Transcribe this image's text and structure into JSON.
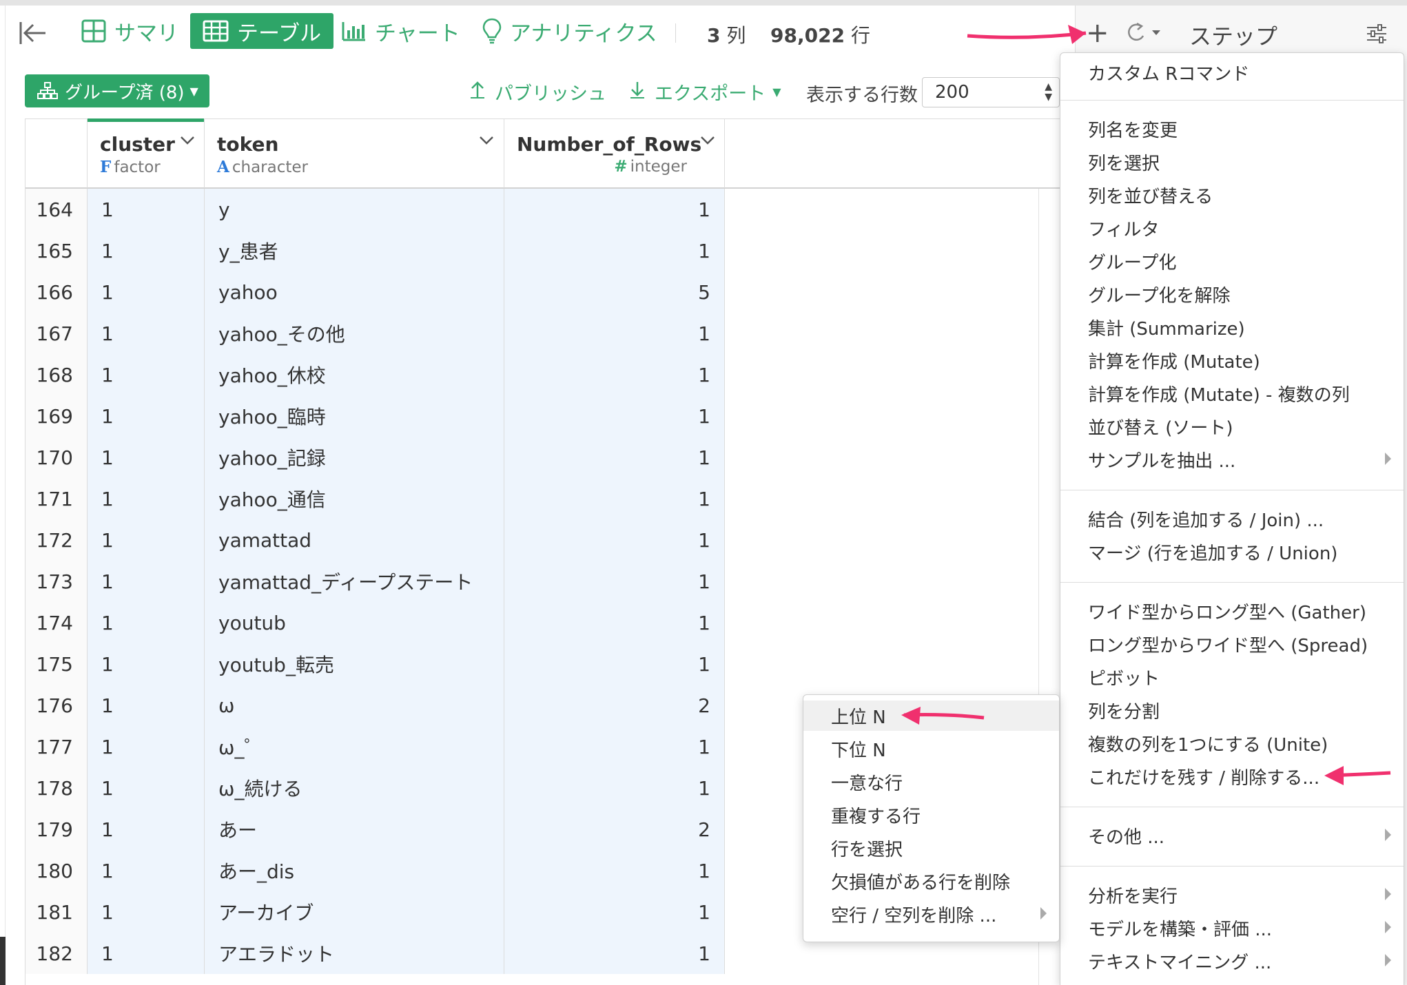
{
  "toolbar": {
    "tabs": [
      {
        "label": "サマリ",
        "icon": "summary-grid-icon"
      },
      {
        "label": "テーブル",
        "icon": "table-icon"
      },
      {
        "label": "チャート",
        "icon": "bar-chart-icon"
      },
      {
        "label": "アナリティクス",
        "icon": "lightbulb-icon"
      }
    ],
    "columns_count": "3",
    "columns_unit": "列",
    "rows_count": "98,022",
    "rows_unit": "行"
  },
  "subbar": {
    "grouped_label": "グループ済 (8)",
    "publish_label": "パブリッシュ",
    "export_label": "エクスポート",
    "rows_to_show_label": "表示する行数",
    "rows_to_show_value": "200"
  },
  "table": {
    "columns": [
      {
        "name": "cluster",
        "type_letter": "F",
        "type": "factor"
      },
      {
        "name": "token",
        "type_letter": "A",
        "type": "character"
      },
      {
        "name": "Number_of_Rows",
        "type_letter": "#",
        "type": "integer"
      }
    ],
    "rows": [
      {
        "idx": "164",
        "cluster": "1",
        "token": "y",
        "count": "1"
      },
      {
        "idx": "165",
        "cluster": "1",
        "token": "y_患者",
        "count": "1"
      },
      {
        "idx": "166",
        "cluster": "1",
        "token": "yahoo",
        "count": "5"
      },
      {
        "idx": "167",
        "cluster": "1",
        "token": "yahoo_その他",
        "count": "1"
      },
      {
        "idx": "168",
        "cluster": "1",
        "token": "yahoo_休校",
        "count": "1"
      },
      {
        "idx": "169",
        "cluster": "1",
        "token": "yahoo_臨時",
        "count": "1"
      },
      {
        "idx": "170",
        "cluster": "1",
        "token": "yahoo_記録",
        "count": "1"
      },
      {
        "idx": "171",
        "cluster": "1",
        "token": "yahoo_通信",
        "count": "1"
      },
      {
        "idx": "172",
        "cluster": "1",
        "token": "yamattad",
        "count": "1"
      },
      {
        "idx": "173",
        "cluster": "1",
        "token": "yamattad_ディープステート",
        "count": "1"
      },
      {
        "idx": "174",
        "cluster": "1",
        "token": "youtub",
        "count": "1"
      },
      {
        "idx": "175",
        "cluster": "1",
        "token": "youtub_転売",
        "count": "1"
      },
      {
        "idx": "176",
        "cluster": "1",
        "token": "ω",
        "count": "2"
      },
      {
        "idx": "177",
        "cluster": "1",
        "token": "ω_゜",
        "count": "1"
      },
      {
        "idx": "178",
        "cluster": "1",
        "token": "ω_続ける",
        "count": "1"
      },
      {
        "idx": "179",
        "cluster": "1",
        "token": "あー",
        "count": "2"
      },
      {
        "idx": "180",
        "cluster": "1",
        "token": "あー_dis",
        "count": "1"
      },
      {
        "idx": "181",
        "cluster": "1",
        "token": "アーカイブ",
        "count": "1"
      },
      {
        "idx": "182",
        "cluster": "1",
        "token": "アエラドット",
        "count": "1"
      }
    ]
  },
  "steps": {
    "title": "ステップ",
    "add_icon": "plus-icon",
    "refresh_icon": "refresh-icon",
    "settings_icon": "sliders-icon"
  },
  "add_menu": {
    "custom_r": "カスタム Rコマンド",
    "group1": [
      "列名を変更",
      "列を選択",
      "列を並び替える",
      "フィルタ",
      "グループ化",
      "グループ化を解除",
      "集計 (Summarize)",
      "計算を作成 (Mutate)",
      "計算を作成 (Mutate) - 複数の列",
      "並び替え (ソート)",
      "サンプルを抽出 ..."
    ],
    "group2": [
      "結合 (列を追加する / Join) ...",
      "マージ (行を追加する / Union)"
    ],
    "group3": [
      "ワイド型からロング型へ (Gather)",
      "ロング型からワイド型へ (Spread)",
      "ピボット",
      "列を分割",
      "複数の列を1つにする (Unite)",
      "これだけを残す / 削除する..."
    ],
    "other": "その他 ...",
    "group4": [
      "分析を実行",
      "モデルを構築・評価 ...",
      "テキストマイニング ..."
    ]
  },
  "sub_menu": {
    "items": [
      "上位 N",
      "下位 N",
      "一意な行",
      "重複する行",
      "行を選択",
      "欠損値がある行を削除",
      "空行 / 空列を削除 ..."
    ]
  },
  "colors": {
    "accent": "#2ea568",
    "annotation_arrow": "#f0306e",
    "type_factor": "#2d7ad8"
  }
}
